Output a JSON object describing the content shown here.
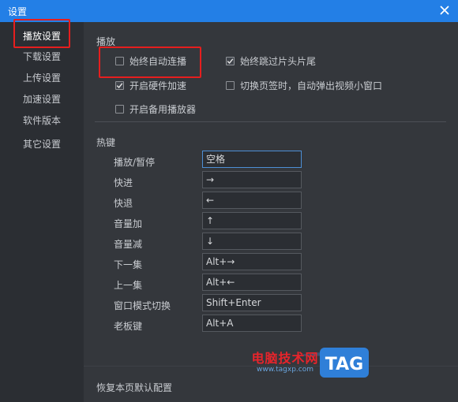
{
  "window": {
    "title": "设置"
  },
  "sidebar": {
    "items": [
      {
        "label": "播放设置",
        "active": true
      },
      {
        "label": "下载设置"
      },
      {
        "label": "上传设置"
      },
      {
        "label": "加速设置"
      },
      {
        "label": "软件版本"
      },
      {
        "label": "其它设置"
      }
    ]
  },
  "playback": {
    "title": "播放",
    "options": [
      {
        "label": "始终自动连播",
        "checked": false
      },
      {
        "label": "始终跳过片头片尾",
        "checked": true
      },
      {
        "label": "开启硬件加速",
        "checked": true
      },
      {
        "label": "切换页签时，自动弹出视频小窗口",
        "checked": false
      },
      {
        "label": "开启备用播放器",
        "checked": false
      }
    ]
  },
  "hotkeys": {
    "title": "热键",
    "items": [
      {
        "label": "播放/暂停",
        "value": "空格"
      },
      {
        "label": "快进",
        "value": "→"
      },
      {
        "label": "快退",
        "value": "←"
      },
      {
        "label": "音量加",
        "value": "↑"
      },
      {
        "label": "音量减",
        "value": "↓"
      },
      {
        "label": "下一集",
        "value": "Alt+→"
      },
      {
        "label": "上一集",
        "value": "Alt+←"
      },
      {
        "label": "窗口模式切换",
        "value": "Shift+Enter"
      },
      {
        "label": "老板键",
        "value": "Alt+A"
      }
    ]
  },
  "footer": {
    "reset_label": "恢复本页默认配置"
  },
  "watermark": {
    "text": "电脑技术网",
    "url": "www.tagxp.com",
    "logo": "TAG"
  },
  "colors": {
    "titlebar": "#237fe6",
    "highlight": "#e61e1e",
    "panel": "#34373c",
    "sidebar": "#2b2e33"
  },
  "icons": {
    "close": "close-icon",
    "check": "checkmark-icon"
  }
}
